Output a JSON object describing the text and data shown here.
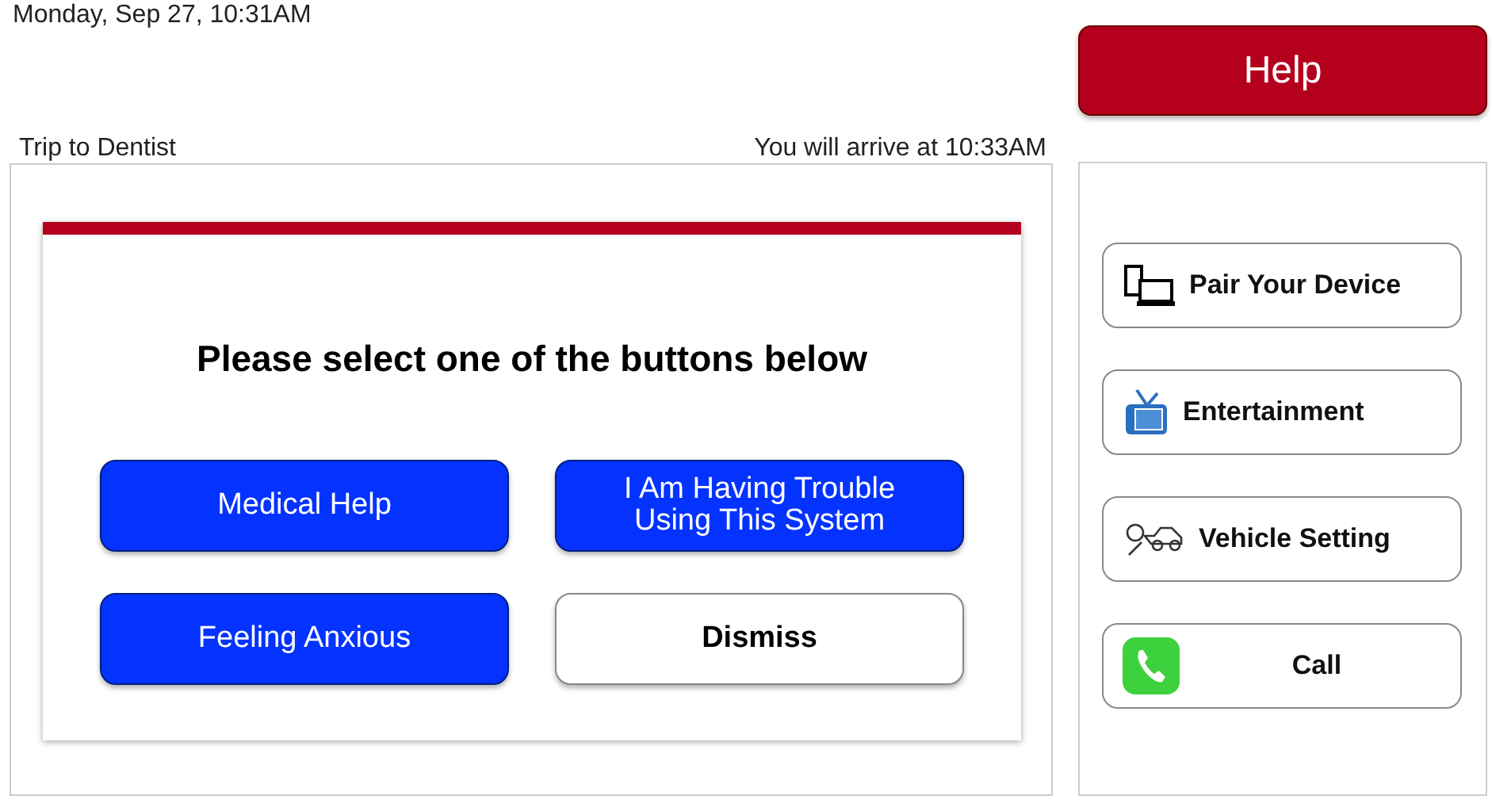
{
  "datetime": "Monday, Sep 27, 10:31AM",
  "help_button": {
    "label": "Help"
  },
  "trip": {
    "title": "Trip to Dentist",
    "arrival": "You will arrive at 10:33AM"
  },
  "dialog": {
    "prompt": "Please select one of the buttons below",
    "buttons": [
      {
        "label": "Medical Help",
        "kind": "primary"
      },
      {
        "label": "I Am Having Trouble Using This System",
        "kind": "primary"
      },
      {
        "label": "Feeling Anxious",
        "kind": "primary"
      },
      {
        "label": "Dismiss",
        "kind": "secondary"
      }
    ]
  },
  "side_menu": [
    {
      "label": "Pair Your Device",
      "kind": "devices"
    },
    {
      "label": "Entertainment",
      "kind": "tv"
    },
    {
      "label": "Vehicle Setting",
      "kind": "vehicle"
    },
    {
      "label": "Call",
      "kind": "phone"
    }
  ]
}
